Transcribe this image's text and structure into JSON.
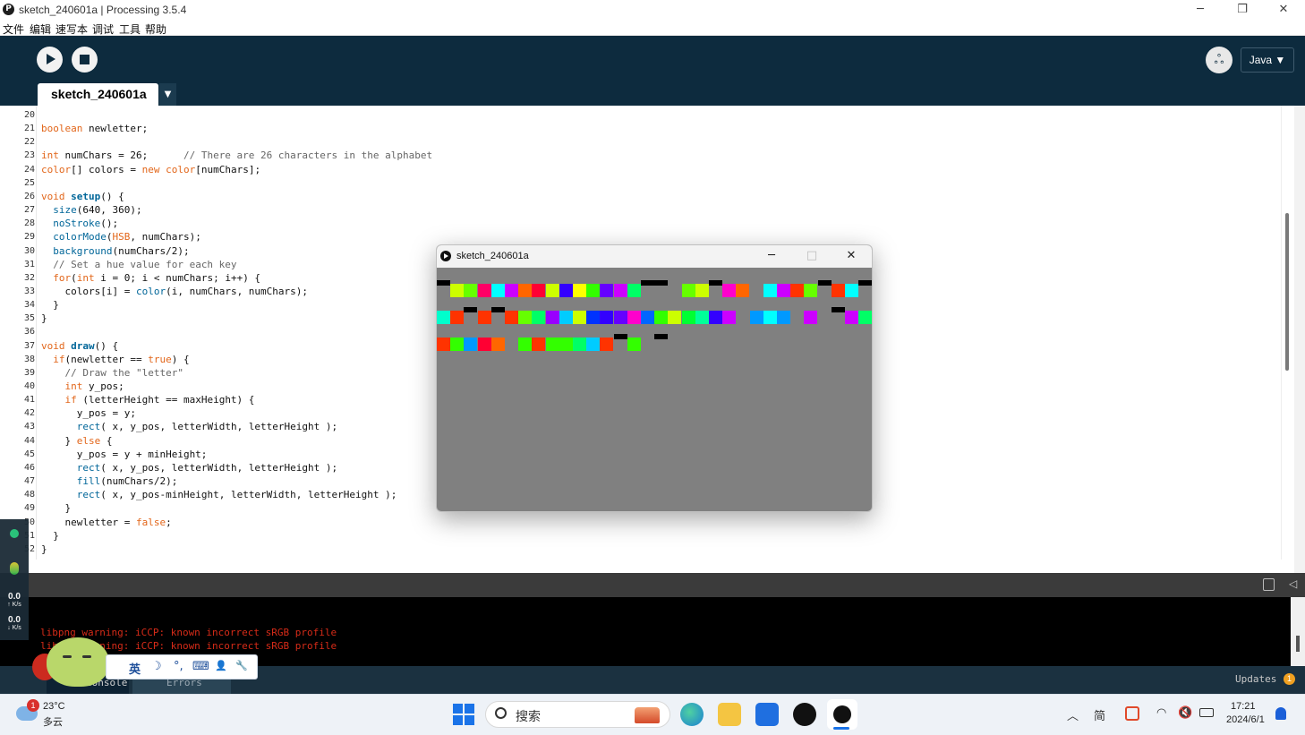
{
  "window": {
    "title": "sketch_240601a | Processing 3.5.4",
    "app_logo": "processing-logo",
    "controls": {
      "minimize": "─",
      "restore": "❐",
      "close": "✕"
    }
  },
  "menu": [
    "文件",
    "编辑",
    "速写本",
    "调试",
    "工具",
    "帮助"
  ],
  "toolbar": {
    "run_icon": "play-icon",
    "stop_icon": "stop-icon",
    "debugger_icon": "butterfly-icon",
    "debugger_glyph": "ஃ",
    "mode": "Java ▼"
  },
  "tab": {
    "name": "sketch_240601a",
    "menu_arrow": "▼"
  },
  "code_lines": [
    {
      "n": "20",
      "parts": [
        {
          "t": "",
          "c": ""
        }
      ]
    },
    {
      "n": "21",
      "parts": [
        {
          "t": "boolean",
          "c": "kw"
        },
        {
          "t": " newletter;",
          "c": ""
        }
      ]
    },
    {
      "n": "22",
      "parts": [
        {
          "t": "",
          "c": ""
        }
      ]
    },
    {
      "n": "23",
      "parts": [
        {
          "t": "int",
          "c": "kw"
        },
        {
          "t": " numChars = 26;      ",
          "c": ""
        },
        {
          "t": "// There are 26 characters in the alphabet",
          "c": "cm"
        }
      ]
    },
    {
      "n": "24",
      "parts": [
        {
          "t": "color",
          "c": "kw"
        },
        {
          "t": "[] colors = ",
          "c": ""
        },
        {
          "t": "new",
          "c": "kw"
        },
        {
          "t": " ",
          "c": ""
        },
        {
          "t": "color",
          "c": "kw"
        },
        {
          "t": "[numChars];",
          "c": ""
        }
      ]
    },
    {
      "n": "25",
      "parts": [
        {
          "t": "",
          "c": ""
        }
      ]
    },
    {
      "n": "26",
      "parts": [
        {
          "t": "void",
          "c": "kw"
        },
        {
          "t": " ",
          "c": ""
        },
        {
          "t": "setup",
          "c": "fnb"
        },
        {
          "t": "() {",
          "c": ""
        }
      ]
    },
    {
      "n": "27",
      "parts": [
        {
          "t": "  ",
          "c": ""
        },
        {
          "t": "size",
          "c": "fn"
        },
        {
          "t": "(640, 360);",
          "c": ""
        }
      ]
    },
    {
      "n": "28",
      "parts": [
        {
          "t": "  ",
          "c": ""
        },
        {
          "t": "noStroke",
          "c": "fn"
        },
        {
          "t": "();",
          "c": ""
        }
      ]
    },
    {
      "n": "29",
      "parts": [
        {
          "t": "  ",
          "c": ""
        },
        {
          "t": "colorMode",
          "c": "fn"
        },
        {
          "t": "(",
          "c": ""
        },
        {
          "t": "HSB",
          "c": "kw"
        },
        {
          "t": ", numChars);",
          "c": ""
        }
      ]
    },
    {
      "n": "30",
      "parts": [
        {
          "t": "  ",
          "c": ""
        },
        {
          "t": "background",
          "c": "fn"
        },
        {
          "t": "(numChars/2);",
          "c": ""
        }
      ]
    },
    {
      "n": "31",
      "parts": [
        {
          "t": "  ",
          "c": ""
        },
        {
          "t": "// Set a hue value for each key",
          "c": "cm"
        }
      ]
    },
    {
      "n": "32",
      "parts": [
        {
          "t": "  ",
          "c": ""
        },
        {
          "t": "for",
          "c": "kw"
        },
        {
          "t": "(",
          "c": ""
        },
        {
          "t": "int",
          "c": "kw"
        },
        {
          "t": " i = 0; i < numChars; i++) {",
          "c": ""
        }
      ]
    },
    {
      "n": "33",
      "parts": [
        {
          "t": "    colors[i] = ",
          "c": ""
        },
        {
          "t": "color",
          "c": "fn"
        },
        {
          "t": "(i, numChars, numChars);",
          "c": ""
        }
      ]
    },
    {
      "n": "34",
      "parts": [
        {
          "t": "  }",
          "c": ""
        }
      ]
    },
    {
      "n": "35",
      "parts": [
        {
          "t": "}",
          "c": ""
        }
      ]
    },
    {
      "n": "36",
      "parts": [
        {
          "t": "",
          "c": ""
        }
      ]
    },
    {
      "n": "37",
      "parts": [
        {
          "t": "void",
          "c": "kw"
        },
        {
          "t": " ",
          "c": ""
        },
        {
          "t": "draw",
          "c": "fnb"
        },
        {
          "t": "() {",
          "c": ""
        }
      ]
    },
    {
      "n": "38",
      "parts": [
        {
          "t": "  ",
          "c": ""
        },
        {
          "t": "if",
          "c": "kw"
        },
        {
          "t": "(newletter == ",
          "c": ""
        },
        {
          "t": "true",
          "c": "kw"
        },
        {
          "t": ") {",
          "c": ""
        }
      ]
    },
    {
      "n": "39",
      "parts": [
        {
          "t": "    ",
          "c": ""
        },
        {
          "t": "// Draw the \"letter\"",
          "c": "cm"
        }
      ]
    },
    {
      "n": "40",
      "parts": [
        {
          "t": "    ",
          "c": ""
        },
        {
          "t": "int",
          "c": "kw"
        },
        {
          "t": " y_pos;",
          "c": ""
        }
      ]
    },
    {
      "n": "41",
      "parts": [
        {
          "t": "    ",
          "c": ""
        },
        {
          "t": "if",
          "c": "kw"
        },
        {
          "t": " (letterHeight == maxHeight) {",
          "c": ""
        }
      ]
    },
    {
      "n": "42",
      "parts": [
        {
          "t": "      y_pos = y;",
          "c": ""
        }
      ]
    },
    {
      "n": "43",
      "parts": [
        {
          "t": "      ",
          "c": ""
        },
        {
          "t": "rect",
          "c": "fn"
        },
        {
          "t": "( x, y_pos, letterWidth, letterHeight );",
          "c": ""
        }
      ]
    },
    {
      "n": "44",
      "parts": [
        {
          "t": "    } ",
          "c": ""
        },
        {
          "t": "else",
          "c": "kw"
        },
        {
          "t": " {",
          "c": ""
        }
      ]
    },
    {
      "n": "45",
      "parts": [
        {
          "t": "      y_pos = y + minHeight;",
          "c": ""
        }
      ]
    },
    {
      "n": "46",
      "parts": [
        {
          "t": "      ",
          "c": ""
        },
        {
          "t": "rect",
          "c": "fn"
        },
        {
          "t": "( x, y_pos, letterWidth, letterHeight );",
          "c": ""
        }
      ]
    },
    {
      "n": "47",
      "parts": [
        {
          "t": "      ",
          "c": ""
        },
        {
          "t": "fill",
          "c": "fn"
        },
        {
          "t": "(numChars/2);",
          "c": ""
        }
      ]
    },
    {
      "n": "48",
      "parts": [
        {
          "t": "      ",
          "c": ""
        },
        {
          "t": "rect",
          "c": "fn"
        },
        {
          "t": "( x, y_pos-minHeight, letterWidth, letterHeight );",
          "c": ""
        }
      ]
    },
    {
      "n": "49",
      "parts": [
        {
          "t": "    }",
          "c": ""
        }
      ]
    },
    {
      "n": "50",
      "parts": [
        {
          "t": "    newletter = ",
          "c": ""
        },
        {
          "t": "false",
          "c": "kw"
        },
        {
          "t": ";",
          "c": ""
        }
      ]
    },
    {
      "n": "51",
      "parts": [
        {
          "t": "  }",
          "c": ""
        }
      ]
    },
    {
      "n": "52",
      "parts": [
        {
          "t": "}",
          "c": ""
        }
      ]
    }
  ],
  "console": {
    "lines": [
      "libpng warning: iCCP: known incorrect sRGB profile",
      "libpng warning: iCCP: known incorrect sRGB profile"
    ],
    "copy_icon": "copy-icon",
    "collapse_icon": "collapse-icon"
  },
  "footer": {
    "tabs": [
      "Console",
      "Errors"
    ],
    "updates_label": "Updates",
    "updates_count": "1"
  },
  "sketch_window": {
    "title": "sketch_240601a",
    "controls": {
      "minimize": "─",
      "maximize": "□",
      "close": "✕"
    },
    "background": "#808080",
    "rows": [
      [
        "#000000",
        "#ccff00",
        "#66ff00",
        "#ff0066",
        "#00ffff",
        "#cc00ff",
        "#ff6600",
        "#ff0033",
        "#ccff00",
        "#3300ff",
        "#ffff00",
        "#33ff00",
        "#6600ff",
        "#cc00ff",
        "#00ff66",
        "#000000",
        "#000000",
        "",
        "#66ff00",
        "#ccff00",
        "#000000",
        "#ff00cc",
        "#ff6600",
        "",
        "#00ffff",
        "#cc00ff",
        "#ff3300",
        "#66ff00",
        "#000000",
        "#ff3300",
        "#00ffff",
        "#000000"
      ],
      [
        "#00ffcc",
        "#ff3300",
        "#000000",
        "#ff3300",
        "#000000",
        "#ff3300",
        "#66ff00",
        "#00ff66",
        "#9900ff",
        "#00ccff",
        "#ccff00",
        "#0033ff",
        "#3300ff",
        "#6600ff",
        "#ff00cc",
        "#0066ff",
        "#33ff00",
        "#ccff00",
        "#00ff33",
        "#00ff99",
        "#3300ff",
        "#cc00ff",
        "",
        "#0099ff",
        "#00ffff",
        "#0099ff",
        "",
        "#cc00ff",
        "",
        "#000000",
        "#cc00ff",
        "#00ff66"
      ],
      [
        "#ff3300",
        "#33ff00",
        "#0099ff",
        "#ff0033",
        "#ff6600",
        "",
        "#33ff00",
        "#ff3300",
        "#33ff00",
        "#33ff00",
        "#00ff66",
        "#00ccff",
        "#ff3300",
        "#000000",
        "#33ff00",
        "",
        "#000000"
      ]
    ]
  },
  "overlays": {
    "net_speed": [
      {
        "value": "0.0",
        "unit": "↑ K/s"
      },
      {
        "value": "0.0",
        "unit": "↓ K/s"
      }
    ],
    "ime_bar": [
      "英",
      "☽",
      "°,",
      "⌨",
      "👤",
      "🔧"
    ]
  },
  "taskbar": {
    "weather_temp": "23°C",
    "weather_desc": "多云",
    "weather_badge": "1",
    "search_placeholder": "搜索",
    "ime_indicator": "简",
    "time": "17:21",
    "date": "2024/6/1"
  }
}
